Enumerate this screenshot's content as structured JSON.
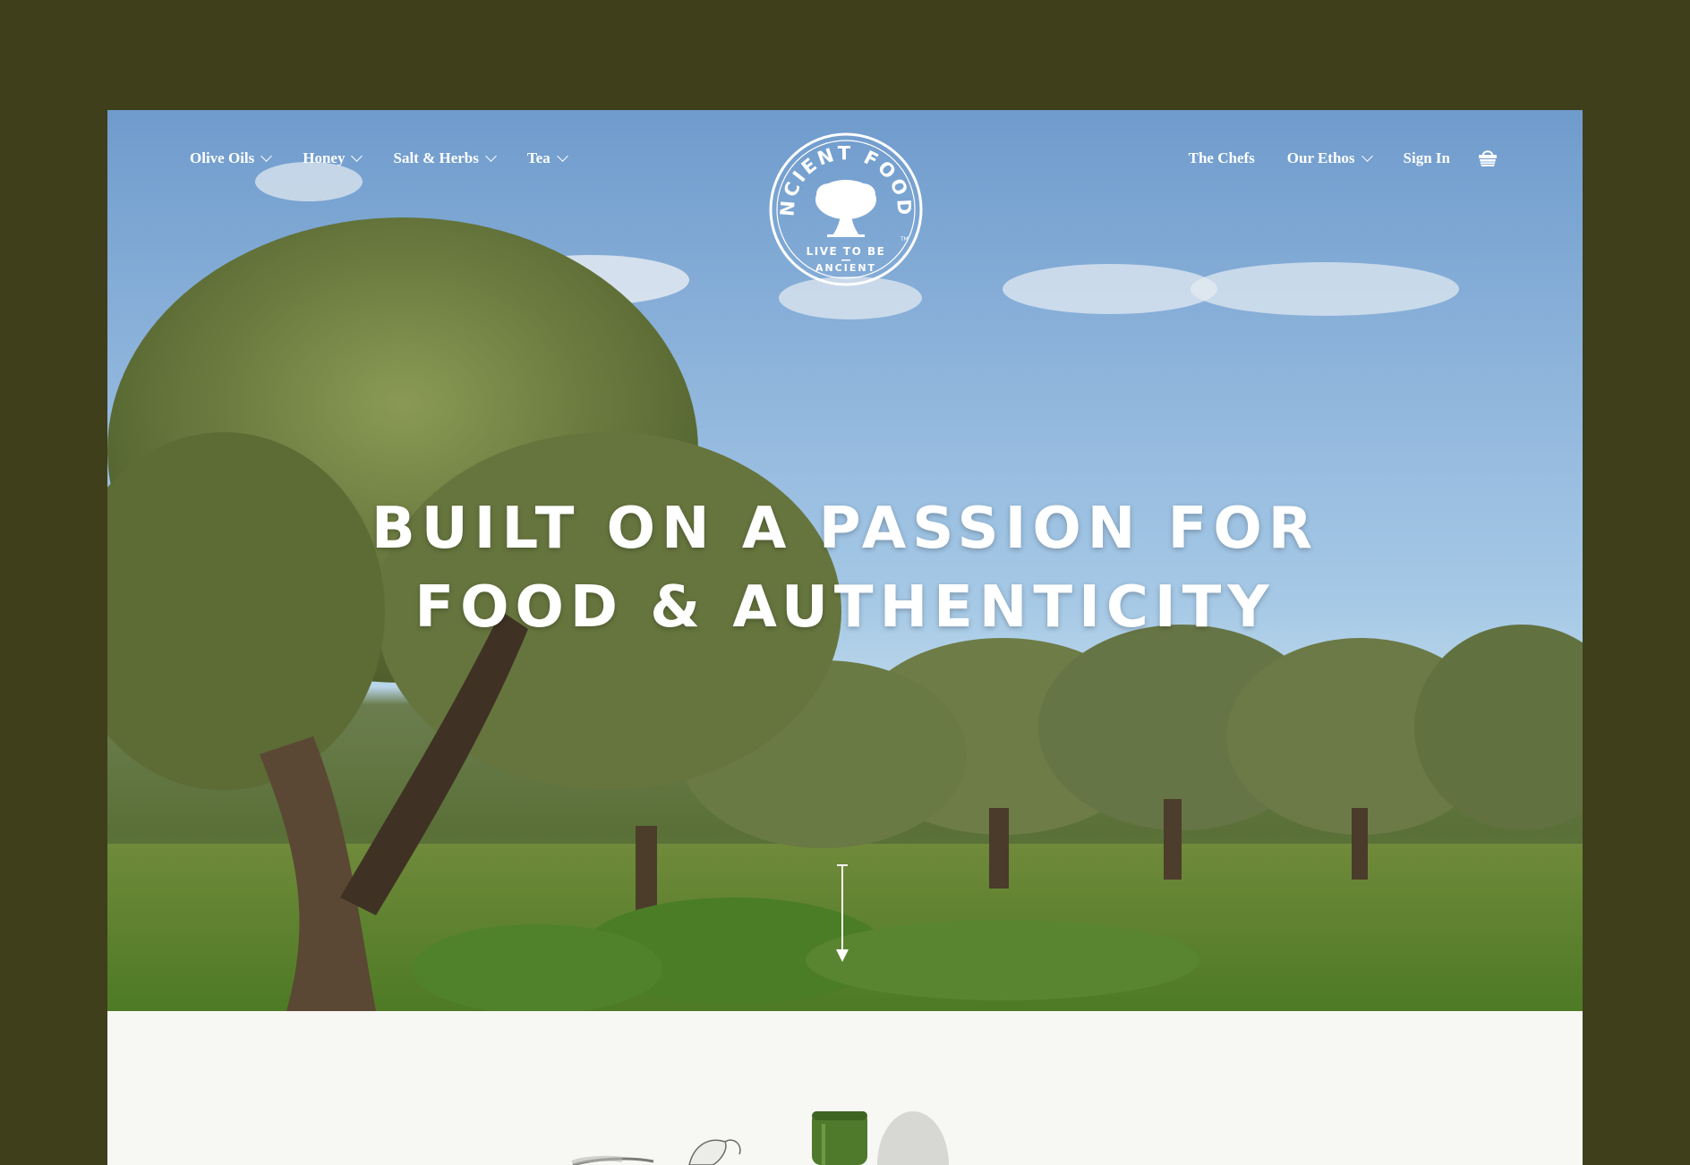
{
  "nav": {
    "left": [
      {
        "label": "Olive Oils",
        "dropdown": true
      },
      {
        "label": "Honey",
        "dropdown": true
      },
      {
        "label": "Salt & Herbs",
        "dropdown": true
      },
      {
        "label": "Tea",
        "dropdown": true
      }
    ],
    "right": [
      {
        "label": "The Chefs",
        "dropdown": false
      },
      {
        "label": "Our Ethos",
        "dropdown": true
      },
      {
        "label": "Sign In",
        "dropdown": false
      }
    ],
    "cart_icon": "basket-icon"
  },
  "logo": {
    "arc_text": "ANCIENT FOODS",
    "tagline_1": "LIVE TO BE",
    "tagline_2": "ANCIENT",
    "trademark": "TM"
  },
  "hero": {
    "title_line_1": "BUILT ON A PASSION FOR",
    "title_line_2": "FOOD & AUTHENTICITY",
    "scroll_icon": "arrow-down-icon"
  },
  "colors": {
    "page_background": "#3f3f1b",
    "section_background": "#f7f7f4",
    "text_on_hero": "#ffffff",
    "bottle_green": "#4f7a2c"
  }
}
